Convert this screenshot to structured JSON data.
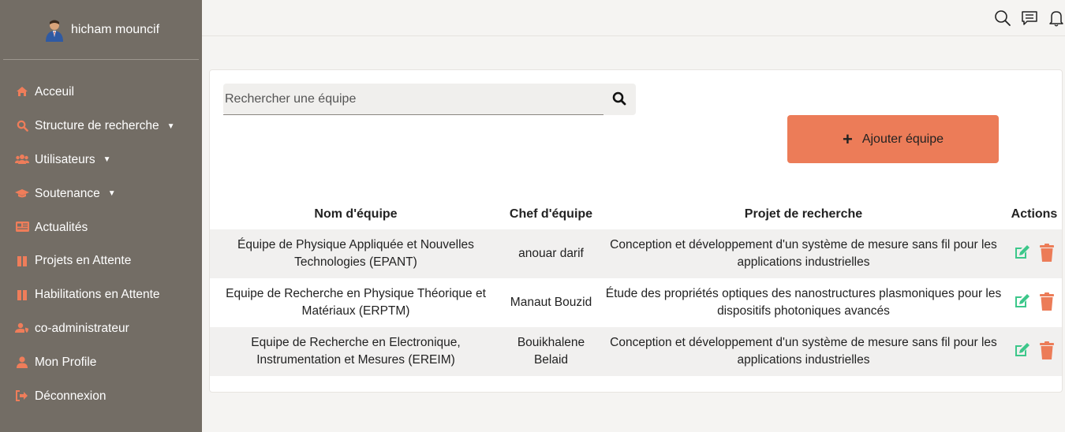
{
  "sidebar": {
    "user_name": "hicham mouncif",
    "items": [
      {
        "label": "Acceuil",
        "icon": "home-icon",
        "caret": false
      },
      {
        "label": "Structure de recherche",
        "icon": "search-icon",
        "caret": true
      },
      {
        "label": "Utilisateurs",
        "icon": "users-icon",
        "caret": true
      },
      {
        "label": "Soutenance",
        "icon": "graduation-cap-icon",
        "caret": true
      },
      {
        "label": "Actualités",
        "icon": "news-icon",
        "caret": false
      },
      {
        "label": "Projets en Attente",
        "icon": "pause-icon",
        "caret": false
      },
      {
        "label": "Habilitations en Attente",
        "icon": "pause-icon",
        "caret": false
      },
      {
        "label": "co-administrateur",
        "icon": "user-shield-icon",
        "caret": false
      },
      {
        "label": "Mon Profile",
        "icon": "user-icon",
        "caret": false
      },
      {
        "label": "Déconnexion",
        "icon": "logout-icon",
        "caret": false
      }
    ]
  },
  "colors": {
    "sidebar_bg": "#736d65",
    "accent": "#ec7c58",
    "edit": "#3cc78a",
    "delete": "#ec7c58"
  },
  "search": {
    "placeholder": "Rechercher une équipe"
  },
  "add_button": {
    "label": "Ajouter équipe"
  },
  "table": {
    "headers": [
      "Nom d'équipe",
      "Chef d'équipe",
      "Projet de recherche",
      "Actions"
    ],
    "rows": [
      {
        "name": "Équipe de Physique Appliquée et Nouvelles Technologies (EPANT)",
        "chef": "anouar darif",
        "projet": "Conception et développement d'un système de mesure sans fil pour les applications industrielles"
      },
      {
        "name": "Equipe de Recherche en Physique Théorique et Matériaux (ERPTM)",
        "chef": "Manaut Bouzid",
        "projet": "Étude des propriétés optiques des nanostructures plasmoniques pour les dispositifs photoniques avancés"
      },
      {
        "name": "Equipe de Recherche en Electronique, Instrumentation et Mesures (EREIM)",
        "chef": "Bouikhalene Belaid",
        "projet": "Conception et développement d'un système de mesure sans fil pour les applications industrielles"
      }
    ]
  }
}
